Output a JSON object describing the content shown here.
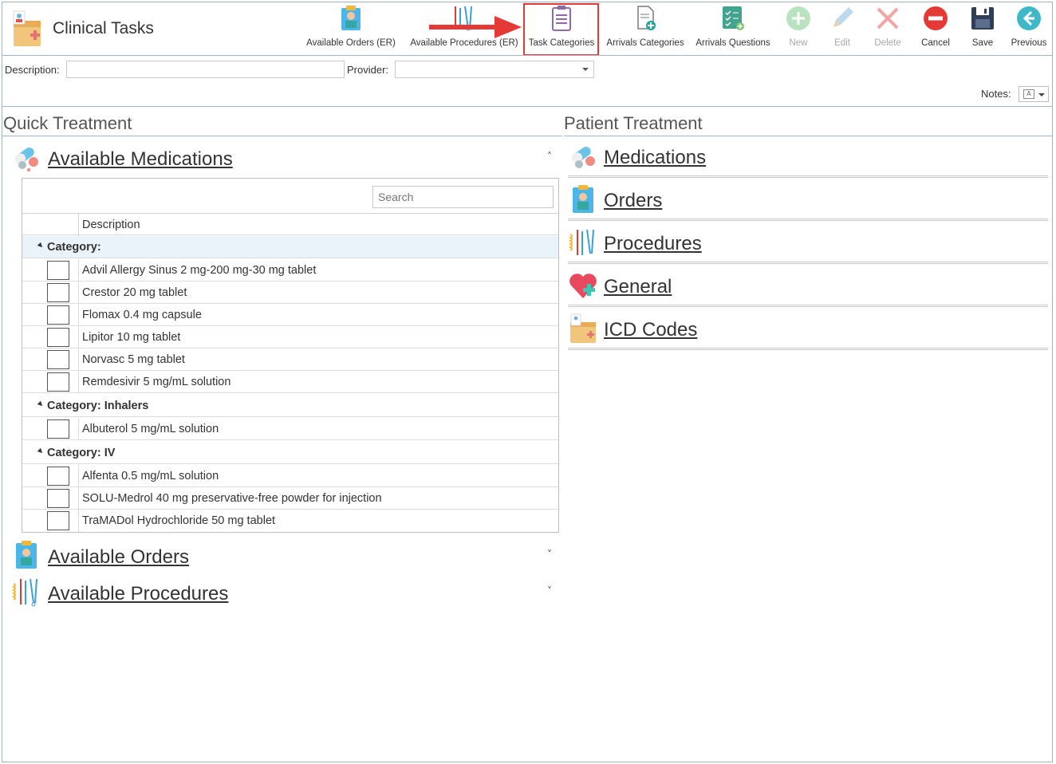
{
  "app": {
    "title": "Clinical Tasks"
  },
  "toolbar": {
    "available_orders": "Available Orders (ER)",
    "available_procedures": "Available Procedures (ER)",
    "task_categories": "Task Categories",
    "arrivals_categories": "Arrivals Categories",
    "arrivals_questions": "Arrivals Questions",
    "new": "New",
    "edit": "Edit",
    "delete": "Delete",
    "cancel": "Cancel",
    "save": "Save",
    "previous": "Previous"
  },
  "form": {
    "description_label": "Description:",
    "description_value": "",
    "provider_label": "Provider:",
    "provider_value": "",
    "notes_label": "Notes:"
  },
  "quick_treatment": {
    "title": "Quick Treatment",
    "medications_title": "Available Medications",
    "orders_title": "Available Orders",
    "procedures_title": "Available Procedures",
    "search_placeholder": "Search",
    "column_description": "Description",
    "groups": [
      {
        "label": "Category:",
        "items": [
          "Advil Allergy Sinus 2 mg-200 mg-30 mg tablet",
          "Crestor 20 mg tablet",
          "Flomax 0.4 mg capsule",
          "Lipitor 10 mg tablet",
          "Norvasc 5 mg tablet",
          "Remdesivir 5 mg/mL solution"
        ]
      },
      {
        "label": "Category: Inhalers",
        "items": [
          "Albuterol 5 mg/mL solution"
        ]
      },
      {
        "label": "Category: IV",
        "items": [
          "Alfenta 0.5 mg/mL solution",
          "SOLU-Medrol 40 mg preservative-free powder for injection",
          "TraMADol Hydrochloride 50 mg tablet"
        ]
      }
    ]
  },
  "patient_treatment": {
    "title": "Patient Treatment",
    "items": [
      "Medications",
      "Orders",
      "Procedures",
      "General",
      "ICD Codes"
    ]
  },
  "colors": {
    "accent_border": "#9db8d2",
    "highlight": "#e53935",
    "group_selected": "#eaf2fa"
  }
}
